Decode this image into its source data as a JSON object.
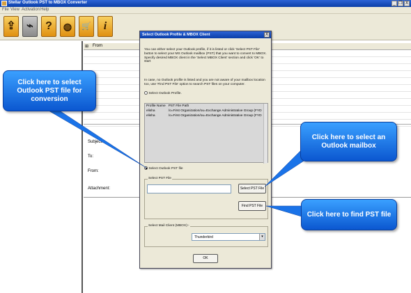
{
  "window": {
    "title": "Stellar Outlook PST to MBOX Converter",
    "buttons": [
      "_",
      "❐",
      "X"
    ]
  },
  "menu": [
    "File",
    "View",
    "Activation",
    "Help"
  ],
  "toolbar": {
    "icons": [
      "open-folder-icon",
      "convert-icon",
      "help-icon",
      "globe-update-icon",
      "cart-icon",
      "info-icon"
    ],
    "glyphs": [
      "⇪",
      "⌁",
      "?",
      "◍",
      "🛒",
      "i"
    ]
  },
  "message_list": {
    "from_label": "From"
  },
  "fields": {
    "subject": "Subject:",
    "to": "To:",
    "from": "From:",
    "attachment": "Attachment:"
  },
  "dialog": {
    "title": "Select Outlook Profile & MBOX Client",
    "close": "X",
    "intro": "You can either select your Outlook profile, if it is listed or click 'Select PST File' button to select your MS Outlook mailbox (PST) that you want to convert to MBOX. Specify desired MBOX client in the 'Select MBOX Client' section and click 'OK' to start",
    "note": "In case, no Outlook profile is listed and you are not aware of your mailbox location too, use 'Find PST File' option to search PST files on your computer.",
    "profile_radio": "Select Outlook Profile.",
    "profile_columns": [
      "Profile Name",
      "PST File Path"
    ],
    "profiles": [
      {
        "name": "elisha",
        "path": "/o=First Organization/ou=Exchange Administrative Group (FYD"
      },
      {
        "name": "elisha",
        "path": "/o=First Organization/ou=Exchange Administrative Group (FYD"
      }
    ],
    "pst_radio": "Select Outlook PST file",
    "pst_group": "Select PST File",
    "pst_value": "",
    "select_pst_button": "Select PST File",
    "find_pst_button": "Find PST File",
    "mail_group": "Select Mail Client (MBOX):-",
    "mail_client": "Thunderbird",
    "ok": "OK"
  },
  "callouts": {
    "left": "Click here to select Outlook PST file for conversion",
    "mailbox": "Click here to select an Outlook mailbox",
    "find": "Click here to find PST file"
  },
  "colors": {
    "callout": "#1a73e8",
    "titlebar": "#0a3ea8"
  }
}
